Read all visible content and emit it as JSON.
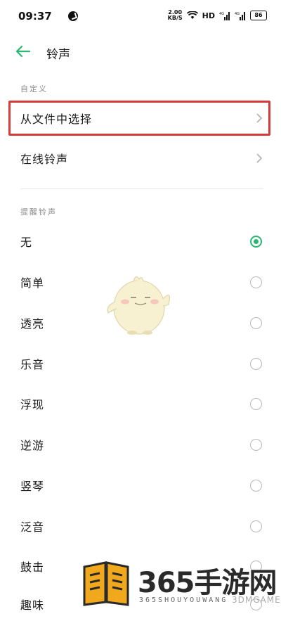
{
  "status": {
    "time": "09:37",
    "net_speed_value": "2.00",
    "net_speed_unit": "KB/S",
    "hd": "HD",
    "signal_1": "4G",
    "signal_2": "4G",
    "battery": "86"
  },
  "header": {
    "title": "铃声"
  },
  "custom_section": {
    "label": "自定义",
    "items": [
      {
        "label": "从文件中选择"
      },
      {
        "label": "在线铃声"
      }
    ]
  },
  "alert_section": {
    "label": "提醒铃声",
    "selected": "无",
    "items": [
      {
        "label": "无",
        "selected": true
      },
      {
        "label": "简单",
        "selected": false
      },
      {
        "label": "透亮",
        "selected": false
      },
      {
        "label": "乐音",
        "selected": false
      },
      {
        "label": "浮现",
        "selected": false
      },
      {
        "label": "逆游",
        "selected": false
      },
      {
        "label": "竖琴",
        "selected": false
      },
      {
        "label": "泛音",
        "selected": false
      },
      {
        "label": "鼓击",
        "selected": false
      },
      {
        "label": "趣味",
        "selected": false
      }
    ]
  },
  "colors": {
    "accent": "#2bb673",
    "highlight": "#d43b3b"
  },
  "watermark": {
    "title": "365手游网",
    "subtitle": "365SHOUYOUWANG",
    "brand": "3DMGAME"
  }
}
